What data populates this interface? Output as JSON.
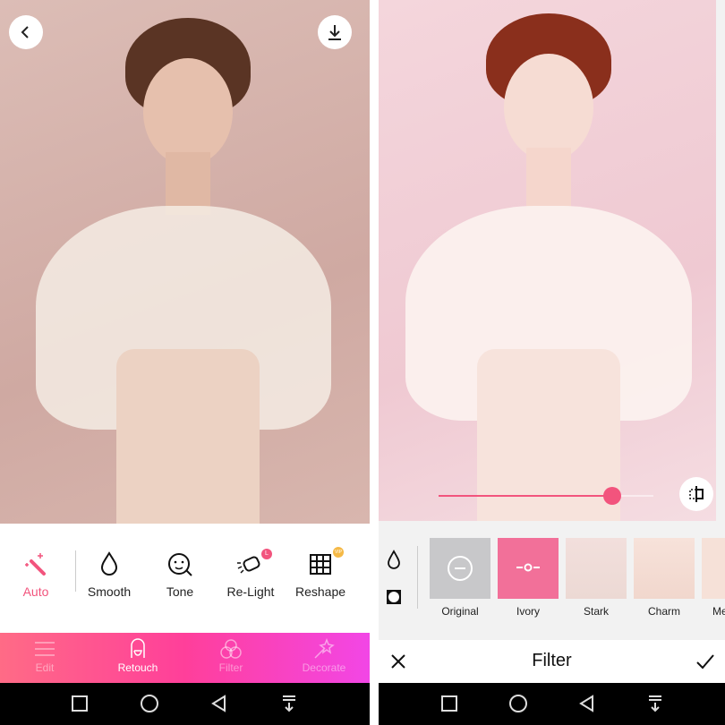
{
  "left_screen": {
    "back_icon": "chevron-left-icon",
    "download_icon": "download-icon",
    "tools": [
      {
        "label": "Auto",
        "icon": "magic-wand-icon",
        "active": true
      },
      {
        "label": "Smooth",
        "icon": "droplet-icon"
      },
      {
        "label": "Tone",
        "icon": "face-tone-icon"
      },
      {
        "label": "Re-Light",
        "icon": "spotlight-icon",
        "badge": "L"
      },
      {
        "label": "Reshape",
        "icon": "grid-warp-icon",
        "badge": "VIP"
      }
    ],
    "bottom_nav": [
      {
        "label": "Edit",
        "icon": "sliders-icon"
      },
      {
        "label": "Retouch",
        "icon": "face-retouch-icon",
        "active": true
      },
      {
        "label": "Filter",
        "icon": "circles-icon"
      },
      {
        "label": "Decorate",
        "icon": "sparkle-wand-icon"
      }
    ]
  },
  "right_screen": {
    "filter_intensity": 0.81,
    "compare_icon": "compare-icon",
    "side_icons": [
      "droplet-icon",
      "vignette-square-icon"
    ],
    "filters": [
      {
        "label": "Original",
        "icon": "minus-circle-icon"
      },
      {
        "label": "Ivory",
        "selected": true,
        "icon": "slider-adjust-icon"
      },
      {
        "label": "Stark"
      },
      {
        "label": "Charm"
      },
      {
        "label": "Me"
      }
    ],
    "title": "Filter",
    "cancel_icon": "close-icon",
    "confirm_icon": "check-icon"
  },
  "colors": {
    "accent": "#f2547d",
    "nav_start": "#ff6b86",
    "nav_end": "#f246e6"
  }
}
